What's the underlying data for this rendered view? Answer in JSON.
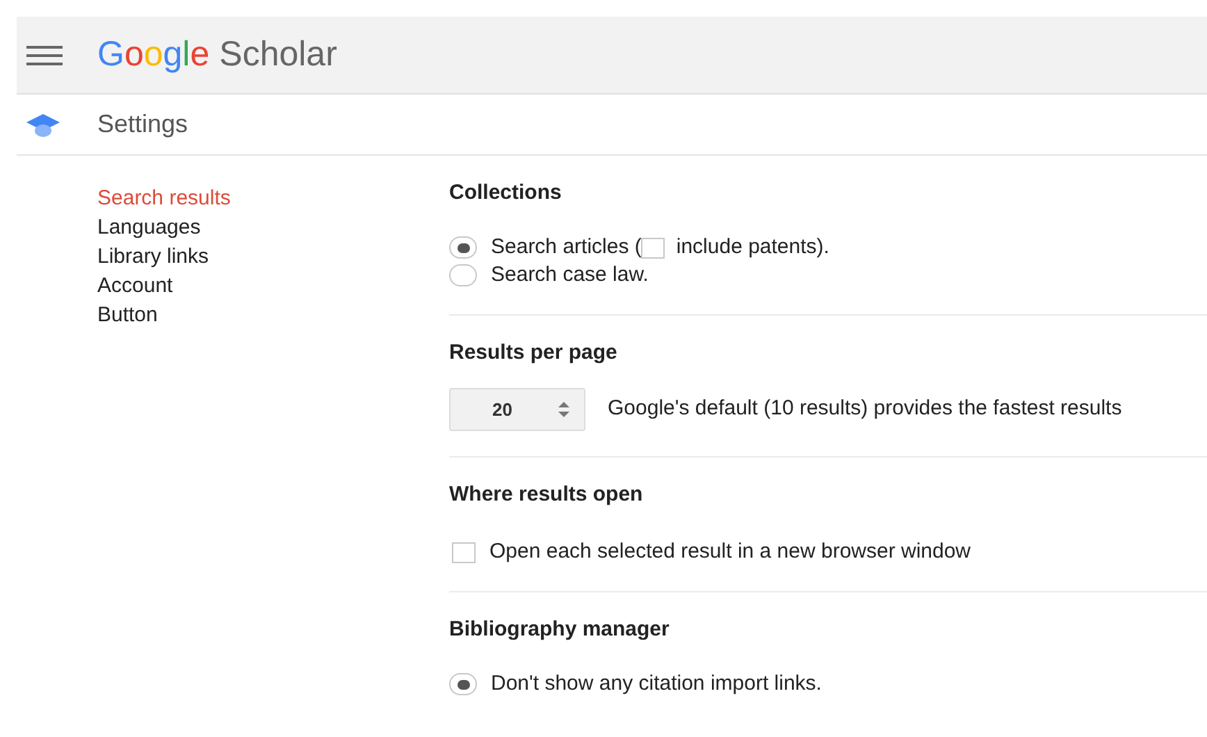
{
  "header": {
    "logo_brand": "Google",
    "logo_product": "Scholar"
  },
  "page_title": "Settings",
  "sidebar": {
    "items": [
      {
        "label": "Search results",
        "selected": true
      },
      {
        "label": "Languages",
        "selected": false
      },
      {
        "label": "Library links",
        "selected": false
      },
      {
        "label": "Account",
        "selected": false
      },
      {
        "label": "Button",
        "selected": false
      }
    ]
  },
  "sections": [
    {
      "title": "Collections",
      "kind": "radios",
      "options": [
        {
          "label_before": "Search articles (",
          "inline_checkbox": {
            "checked": false
          },
          "label_after": "include patents).",
          "selected": true
        },
        {
          "label_before": "Search case law.",
          "selected": false
        }
      ]
    },
    {
      "title": "Results per page",
      "kind": "select",
      "value": "20",
      "description": "Google's default (10 results) provides the fastest results"
    },
    {
      "title": "Where results open",
      "kind": "checkbox",
      "label": "Open each selected result in a new browser window",
      "checked": false
    },
    {
      "title": "Bibliography manager",
      "kind": "radios",
      "options": [
        {
          "label_before": "Don't show any citation import links.",
          "selected": true
        }
      ]
    }
  ]
}
